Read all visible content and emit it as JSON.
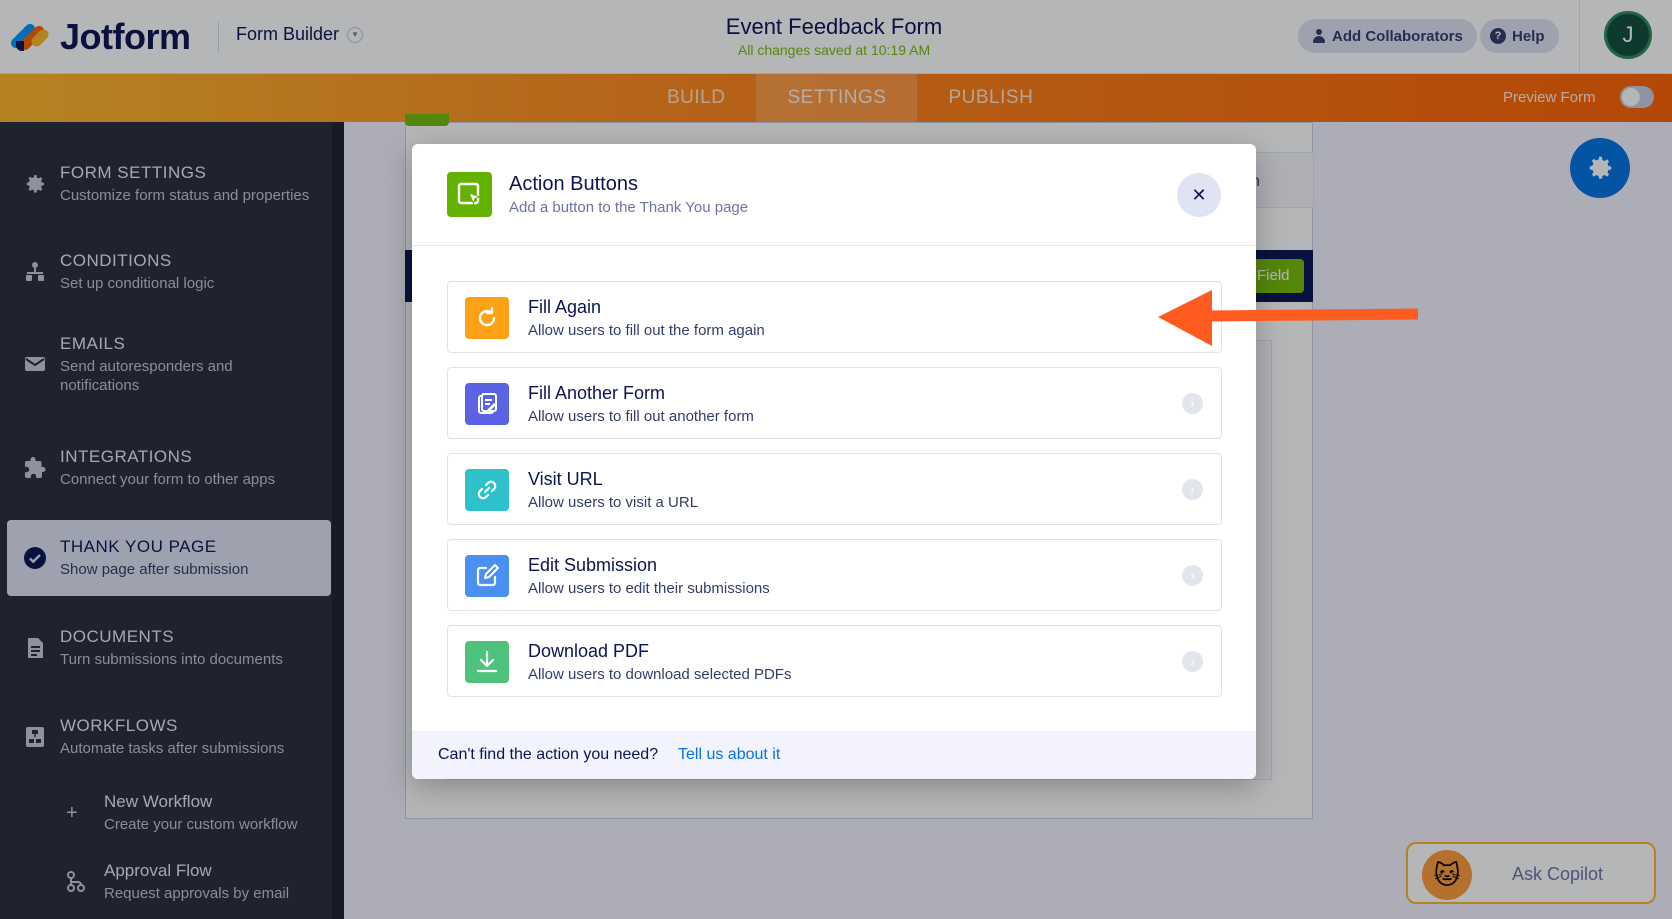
{
  "header": {
    "logo_text": "Jotform",
    "builder_label": "Form Builder",
    "form_title": "Event Feedback Form",
    "saved_status": "All changes saved at 10:19 AM",
    "collaborators_label": "Add Collaborators",
    "help_label": "Help",
    "avatar_initial": "J"
  },
  "nav": {
    "tabs": [
      {
        "label": "BUILD"
      },
      {
        "label": "SETTINGS"
      },
      {
        "label": "PUBLISH"
      }
    ],
    "preview_label": "Preview Form"
  },
  "sidebar": {
    "items": [
      {
        "title": "FORM SETTINGS",
        "subtitle": "Customize form status and properties",
        "icon": "gear-icon"
      },
      {
        "title": "CONDITIONS",
        "subtitle": "Set up conditional logic",
        "icon": "conditions-icon"
      },
      {
        "title": "EMAILS",
        "subtitle": "Send autoresponders and notifications",
        "icon": "envelope-icon"
      },
      {
        "title": "INTEGRATIONS",
        "subtitle": "Connect your form to other apps",
        "icon": "puzzle-icon"
      },
      {
        "title": "THANK YOU PAGE",
        "subtitle": "Show page after submission",
        "icon": "check-circle-icon"
      },
      {
        "title": "DOCUMENTS",
        "subtitle": "Turn submissions into documents",
        "icon": "document-icon"
      },
      {
        "title": "WORKFLOWS",
        "subtitle": "Automate tasks after submissions",
        "icon": "workflow-icon"
      }
    ],
    "sub_items": [
      {
        "title": "New Workflow",
        "subtitle": "Create your custom workflow",
        "icon": "plus-icon"
      },
      {
        "title": "Approval Flow",
        "subtitle": "Request approvals by email",
        "icon": "approval-flow-icon"
      }
    ]
  },
  "background": {
    "field_button": "Field",
    "tab_fragment": "n"
  },
  "modal": {
    "title": "Action Buttons",
    "subtitle": "Add a button to the Thank You page",
    "actions": [
      {
        "title": "Fill Again",
        "description": "Allow users to fill out the form again",
        "icon": "refresh-icon",
        "color": "#ffa114"
      },
      {
        "title": "Fill Another Form",
        "description": "Allow users to fill out another form",
        "icon": "form-edit-icon",
        "color": "#5a63e1"
      },
      {
        "title": "Visit URL",
        "description": "Allow users to visit a URL",
        "icon": "link-icon",
        "color": "#2ec1c9"
      },
      {
        "title": "Edit Submission",
        "description": "Allow users to edit their submissions",
        "icon": "edit-icon",
        "color": "#4a90f0"
      },
      {
        "title": "Download PDF",
        "description": "Allow users to download selected PDFs",
        "icon": "download-icon",
        "color": "#4fc27c"
      }
    ],
    "footer_question": "Can't find the action you need?",
    "footer_link": "Tell us about it"
  },
  "copilot": {
    "label": "Ask Copilot"
  },
  "colors": {
    "brand_orange": "#ff6100",
    "accent_blue": "#0075e3",
    "annotation_arrow": "#ff5a1f"
  }
}
